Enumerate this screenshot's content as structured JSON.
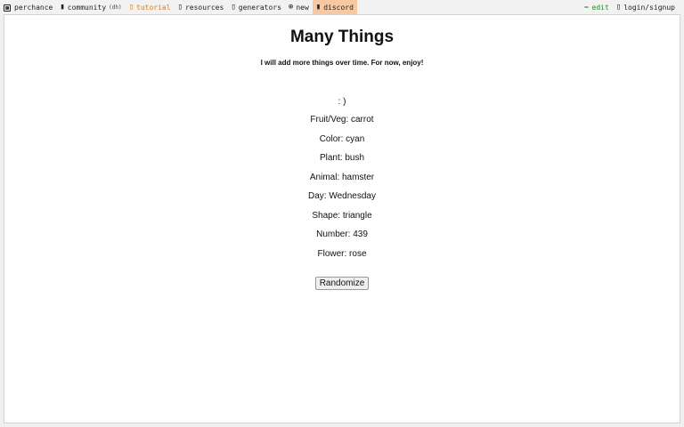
{
  "nav": {
    "left": [
      {
        "label": "perchance",
        "icon": "dice-icon"
      },
      {
        "label": "community",
        "suffix": "(dh)",
        "icon": "people-icon"
      },
      {
        "label": "tutorial",
        "icon": "book-icon"
      },
      {
        "label": "resources",
        "icon": "resources-icon"
      },
      {
        "label": "generators",
        "icon": "generators-icon"
      },
      {
        "label": "new",
        "icon": "plus-circle-icon"
      },
      {
        "label": "discord",
        "icon": "discord-icon"
      }
    ],
    "right": [
      {
        "label": "edit",
        "icon": "pencil-icon"
      },
      {
        "label": "login/signup",
        "icon": "user-icon"
      }
    ],
    "colors": {
      "tutorial": "#e07a1a",
      "discord_bg": "#f8c9a0",
      "edit": "#2a8a2a"
    }
  },
  "page": {
    "title": "Many Things",
    "subtitle": "I will add more things over time. For now, enjoy!",
    "lines": [
      ": )",
      "Fruit/Veg: carrot",
      "Color: cyan",
      "Plant: bush",
      "Animal: hamster",
      "Day: Wednesday",
      "Shape: triangle",
      "Number: 439",
      "Flower: rose"
    ],
    "button_label": "Randomize"
  }
}
